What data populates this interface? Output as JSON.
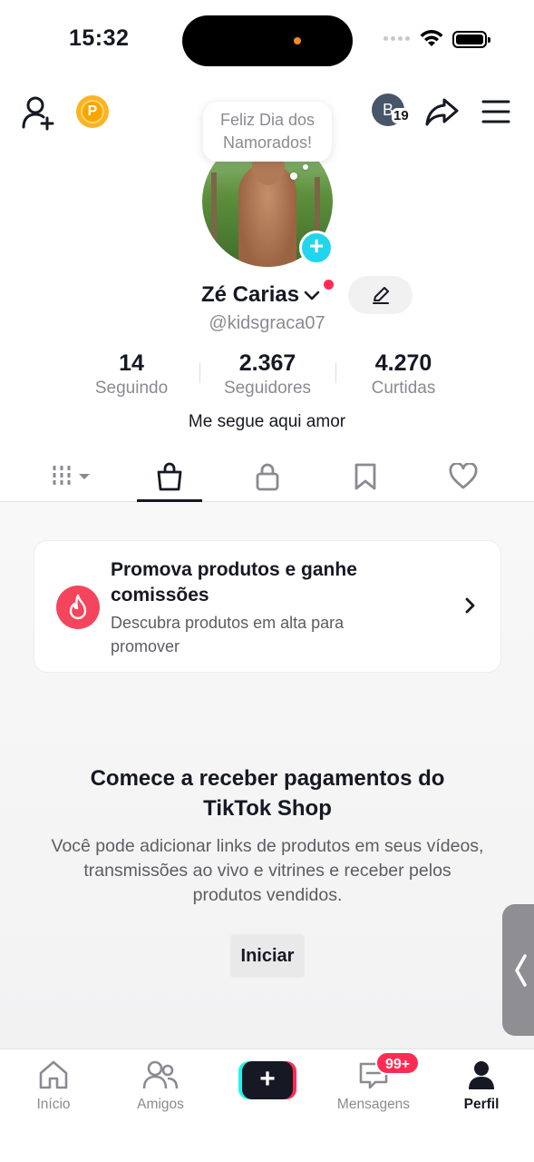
{
  "status_bar": {
    "time": "15:32"
  },
  "header": {
    "coin_letter": "P",
    "avatar_letter": "B",
    "avatar_count": "19"
  },
  "profile": {
    "bubble_text_line1": "Feliz Dia dos",
    "bubble_text_line2": "Namorados!",
    "display_name": "Zé Carias",
    "username": "@kidsgraca07",
    "bio": "Me segue aqui amor",
    "stats": [
      {
        "value": "14",
        "label": "Seguindo"
      },
      {
        "value": "2.367",
        "label": "Seguidores"
      },
      {
        "value": "4.270",
        "label": "Curtidas"
      }
    ]
  },
  "tabs": [
    "videos-grid",
    "shop",
    "private",
    "saved",
    "liked"
  ],
  "promo_card": {
    "title": "Promova produtos e ganhe comissões",
    "description": "Descubra produtos em alta para promover"
  },
  "shop_section": {
    "title": "Comece a receber pagamentos do TikTok Shop",
    "description": "Você pode adicionar links de produtos em seus vídeos, transmissões ao vivo e vitrines e receber pelos produtos vendidos.",
    "start_label": "Iniciar"
  },
  "bottom_nav": {
    "home": "Início",
    "friends": "Amigos",
    "create": "+",
    "messages": "Mensagens",
    "messages_badge": "99+",
    "profile": "Perfil"
  },
  "colors": {
    "accent_red": "#fe2c55",
    "accent_cyan": "#20d5ec",
    "text_primary": "#161823",
    "text_secondary": "#8a8b91"
  }
}
